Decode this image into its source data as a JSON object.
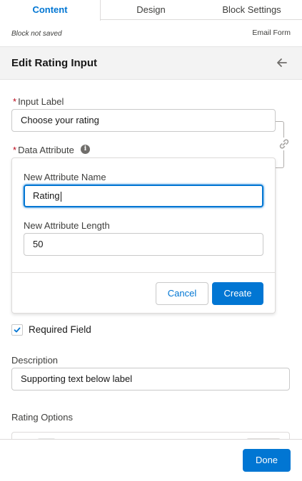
{
  "tabs": [
    {
      "label": "Content",
      "active": true
    },
    {
      "label": "Design",
      "active": false
    },
    {
      "label": "Block Settings",
      "active": false
    }
  ],
  "meta": {
    "status": "Block not saved",
    "form_type": "Email Form"
  },
  "panel": {
    "title": "Edit Rating Input",
    "back_icon": "arrow-left-icon"
  },
  "input_label": {
    "label": "Input Label",
    "required_mark": "*",
    "value": "Choose your rating"
  },
  "data_attribute": {
    "label": "Data Attribute",
    "required_mark": "*",
    "info_icon": "info-icon",
    "link_icon": "link-icon"
  },
  "popover": {
    "name_label": "New Attribute Name",
    "name_value": "Rating",
    "length_label": "New Attribute Length",
    "length_value": "50",
    "cancel_label": "Cancel",
    "create_label": "Create"
  },
  "required_field": {
    "label": "Required Field",
    "checked": true
  },
  "description": {
    "label": "Description",
    "value": "Supporting text below label"
  },
  "rating_options": {
    "label": "Rating Options"
  },
  "footer": {
    "done_label": "Done"
  },
  "colors": {
    "brand": "#0176d3",
    "required": "#ba0517",
    "header_bg": "#f3f3f3",
    "border": "#c9c9c9"
  }
}
